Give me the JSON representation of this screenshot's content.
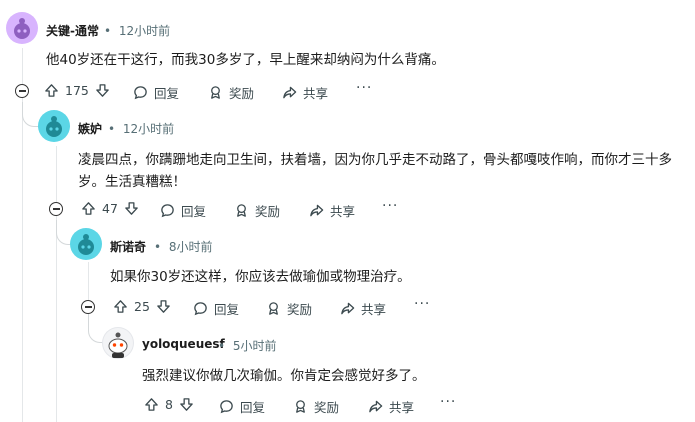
{
  "comments": [
    {
      "author": "关键-通常",
      "time": "12小时前",
      "text": "他40岁还在干这行，而我30多岁了，早上醒来却纳闷为什么背痛。",
      "votes": "175",
      "avatar_color": "#d8b4fe"
    },
    {
      "author": "嫉妒",
      "time": "12小时前",
      "text": "凌晨四点，你蹒跚地走向卫生间，扶着墙，因为你几乎走不动路了，骨头都嘎吱作响，而你才三十多岁。生活真糟糕！",
      "votes": "47",
      "avatar_color": "#5bd6e6"
    },
    {
      "author": "斯诺奇",
      "time": "8小时前",
      "text": "如果你30岁还这样，你应该去做瑜伽或物理治疗。",
      "votes": "25",
      "avatar_color": "#5bd6e6"
    },
    {
      "author": "yoloqueuesf",
      "time": "5小时前",
      "text": "强烈建议你做几次瑜伽。你肯定会感觉好多了。",
      "votes": "8",
      "avatar_color": "#e5e7eb"
    }
  ],
  "actions": {
    "reply": "回复",
    "award": "奖励",
    "share": "共享",
    "more": "···"
  },
  "separator": "•"
}
